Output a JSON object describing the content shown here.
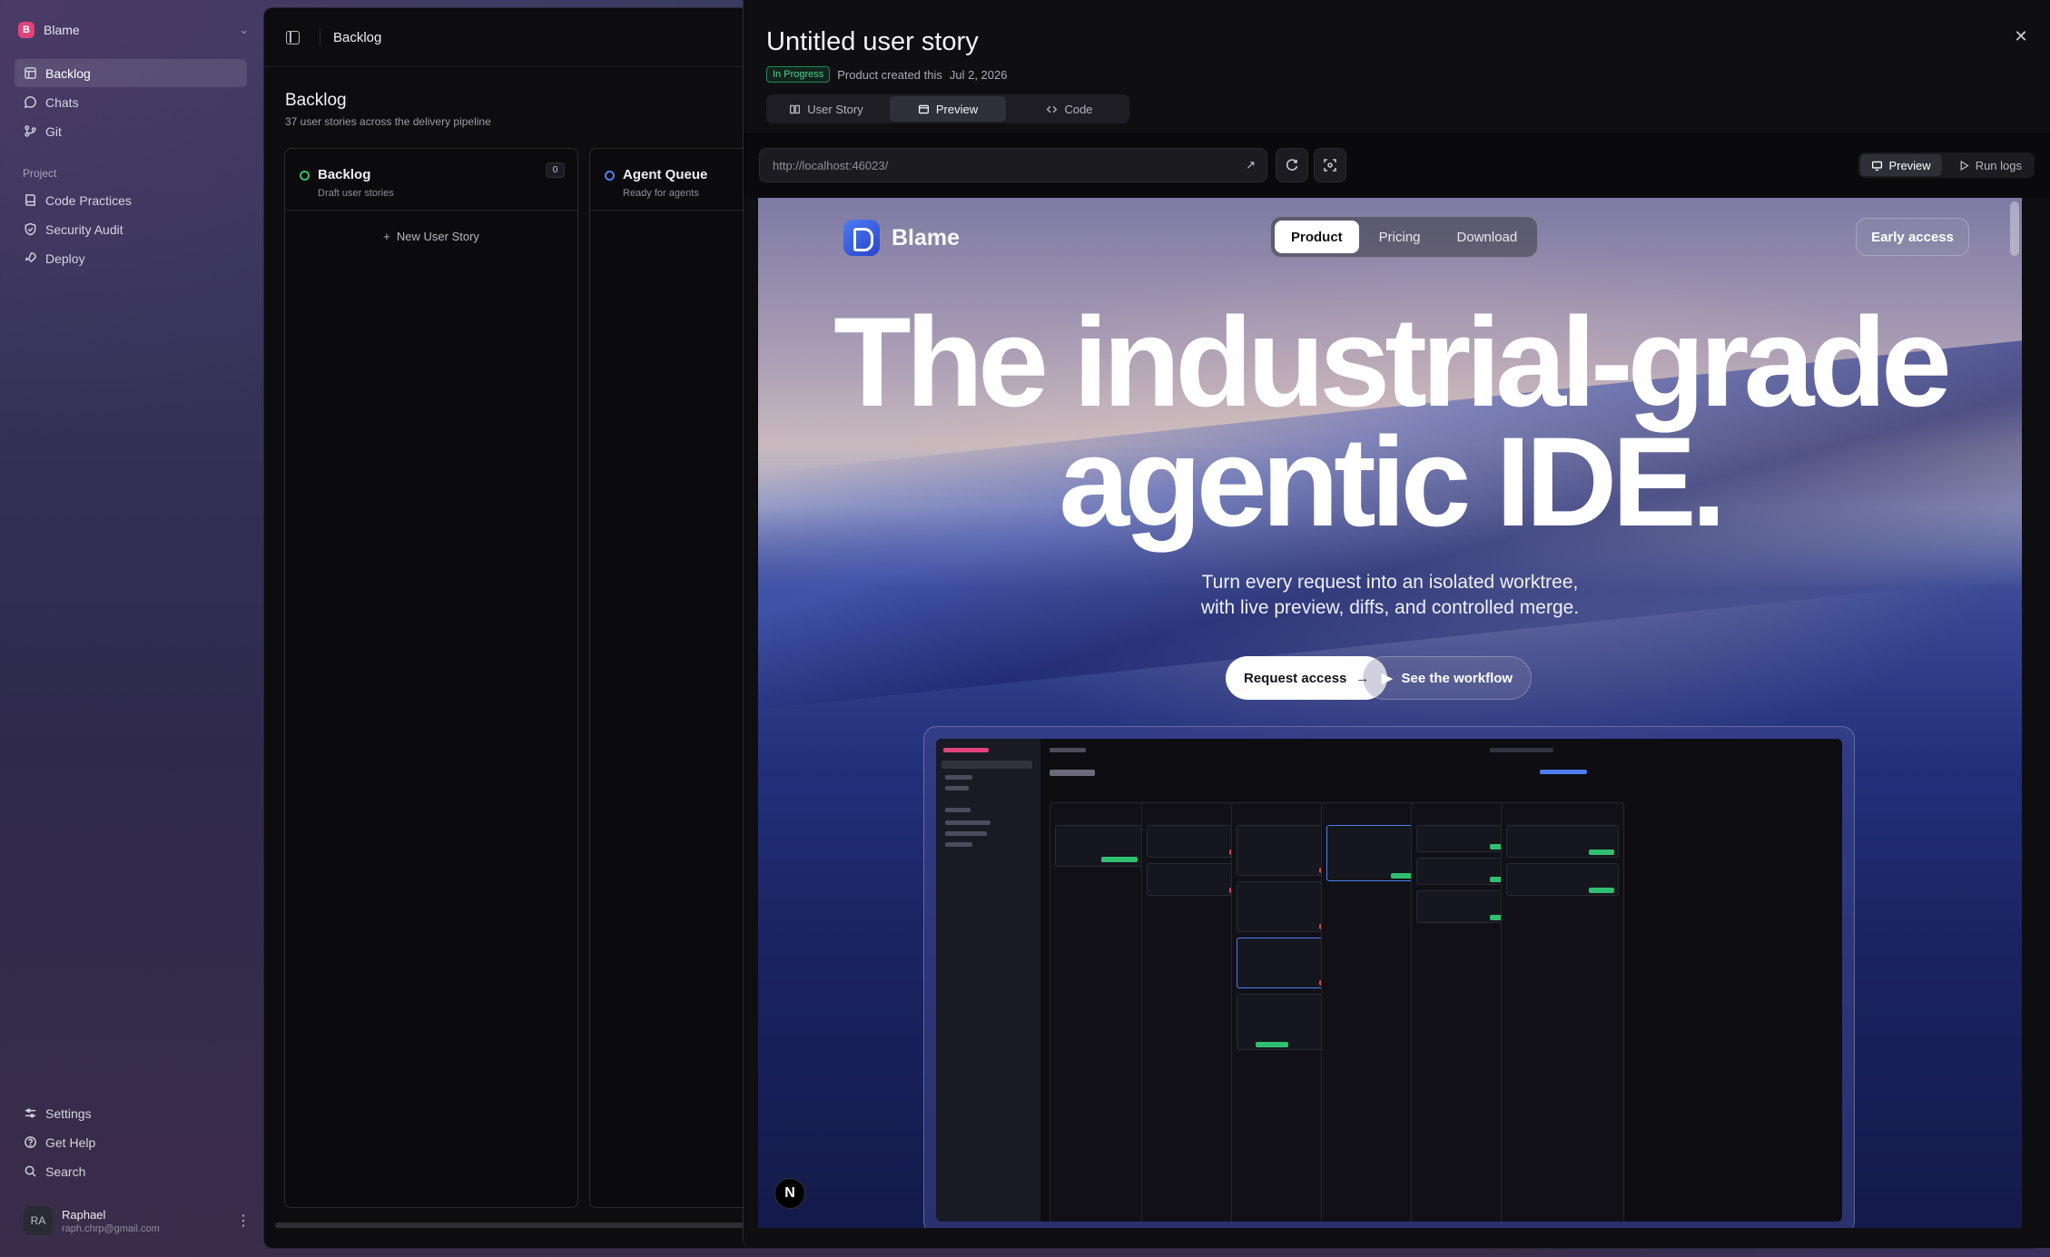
{
  "sidebar": {
    "workspace": "Blame",
    "workspace_initial": "B",
    "nav": [
      {
        "label": "Backlog",
        "icon": "backlog-icon",
        "active": true
      },
      {
        "label": "Chats",
        "icon": "chat-icon"
      },
      {
        "label": "Git",
        "icon": "git-icon"
      }
    ],
    "project_label": "Project",
    "project_items": [
      {
        "label": "Code Practices",
        "icon": "book-icon"
      },
      {
        "label": "Security Audit",
        "icon": "shield-icon"
      },
      {
        "label": "Deploy",
        "icon": "rocket-icon"
      }
    ],
    "bottom": [
      {
        "label": "Settings",
        "icon": "settings-icon"
      },
      {
        "label": "Get Help",
        "icon": "help-icon"
      },
      {
        "label": "Search",
        "icon": "search-icon"
      }
    ],
    "user": {
      "initials": "RA",
      "name": "Raphael",
      "email": "raph.chrp@gmail.com"
    }
  },
  "topbar": {
    "title": "Backlog"
  },
  "backlog": {
    "title": "Backlog",
    "subtitle": "37 user stories across the delivery pipeline",
    "columns": [
      {
        "title": "Backlog",
        "subtitle": "Draft user stories",
        "count": "0",
        "status_color": "#2fbf71"
      },
      {
        "title": "Agent Queue",
        "subtitle": "Ready for agents",
        "status_color": "#4f7df0"
      }
    ],
    "new_story": "New User Story"
  },
  "panel": {
    "title": "Untitled user story",
    "status": "In Progress",
    "meta_prefix": "Product created this",
    "date": "Jul 2, 2026",
    "tabs": [
      {
        "label": "User Story",
        "icon": "book-icon"
      },
      {
        "label": "Preview",
        "icon": "window-icon",
        "active": true
      },
      {
        "label": "Code",
        "icon": "code-icon"
      }
    ],
    "url": "http://localhost:46023/",
    "view_toggle": [
      {
        "label": "Preview",
        "active": true
      },
      {
        "label": "Run logs"
      }
    ]
  },
  "site": {
    "brand": "Blame",
    "nav": [
      "Product",
      "Pricing",
      "Download"
    ],
    "nav_active": "Product",
    "early_access": "Early access",
    "hero_line1": "The industrial-grade",
    "hero_line2": "agentic IDE.",
    "sub_line1": "Turn every request into an isolated worktree,",
    "sub_line2": "with live preview, diffs, and controlled merge.",
    "cta_primary": "Request access",
    "cta_secondary": "See the workflow",
    "badge": "N"
  },
  "colors": {
    "accent": "#4f7df0",
    "success": "#2fbf71",
    "brand": "#e0437a"
  }
}
